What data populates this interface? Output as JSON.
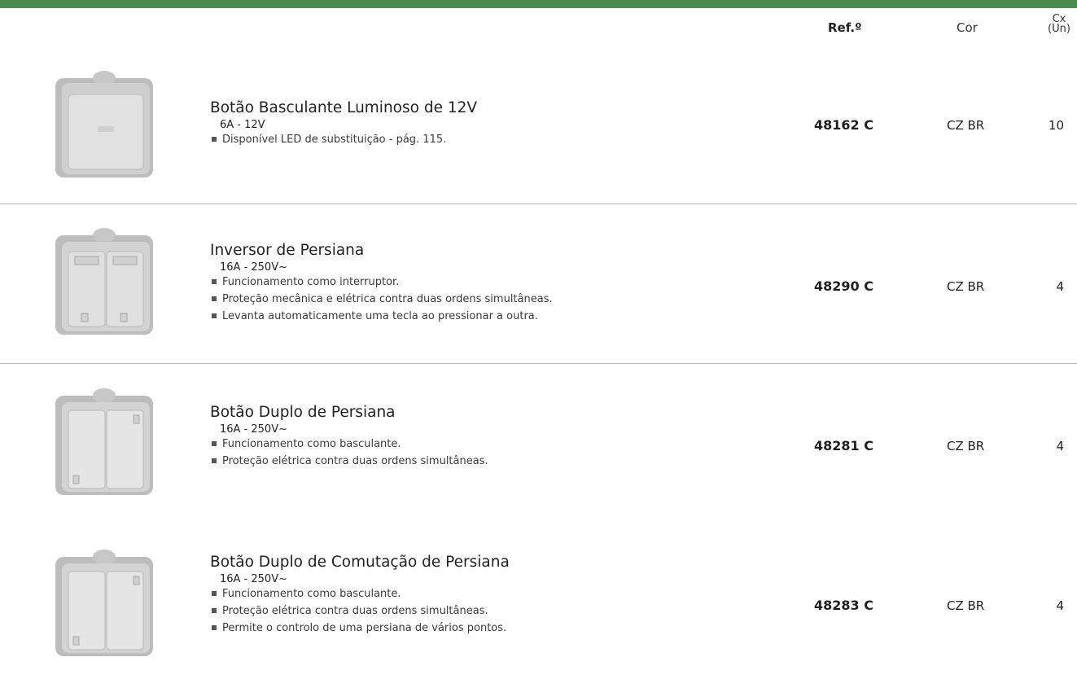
{
  "header": {
    "ref_label": "Ref.º",
    "cor_label": "Cor",
    "cx_label_line1": "Cx",
    "cx_label_line2": "(Un)"
  },
  "products": [
    {
      "title": "Botão Basculante Luminoso de 12V",
      "spec": "6A - 12V",
      "bullets": [
        "Disponível LED de substituição - pág. 115."
      ],
      "ref": "48162 C",
      "cor": "CZ BR",
      "cx": "10"
    },
    {
      "title": "Inversor de Persiana",
      "spec": "16A - 250V~",
      "bullets": [
        "Funcionamento como interruptor.",
        "Proteção mecânica e elétrica contra duas ordens simultâneas.",
        "Levanta automaticamente uma tecla ao pressionar a outra."
      ],
      "ref": "48290 C",
      "cor": "CZ BR",
      "cx": "4"
    },
    {
      "title": "Botão Duplo de Persiana",
      "spec": "16A - 250V~",
      "bullets": [
        "Funcionamento como basculante.",
        "Proteção elétrica contra duas ordens simultâneas."
      ],
      "ref": "48281 C",
      "cor": "CZ BR",
      "cx": "4"
    },
    {
      "title": "Botão Duplo de Comutação de Persiana",
      "spec": "16A - 250V~",
      "bullets": [
        "Funcionamento como basculante.",
        "Proteção elétrica contra duas ordens simultâneas.",
        "Permite o controlo de uma persiana de vários pontos."
      ],
      "ref": "48283 C",
      "cor": "CZ BR",
      "cx": "4"
    }
  ],
  "colors": {
    "accent_bar": "#4a8a4f",
    "divider": "#b9b9b9",
    "housing": "#c9c9c9"
  },
  "icons": [
    "single-rocker-switch-icon",
    "stop-blind-switch-icon",
    "double-blind-switch-icon",
    "double-blind-switch-icon"
  ]
}
